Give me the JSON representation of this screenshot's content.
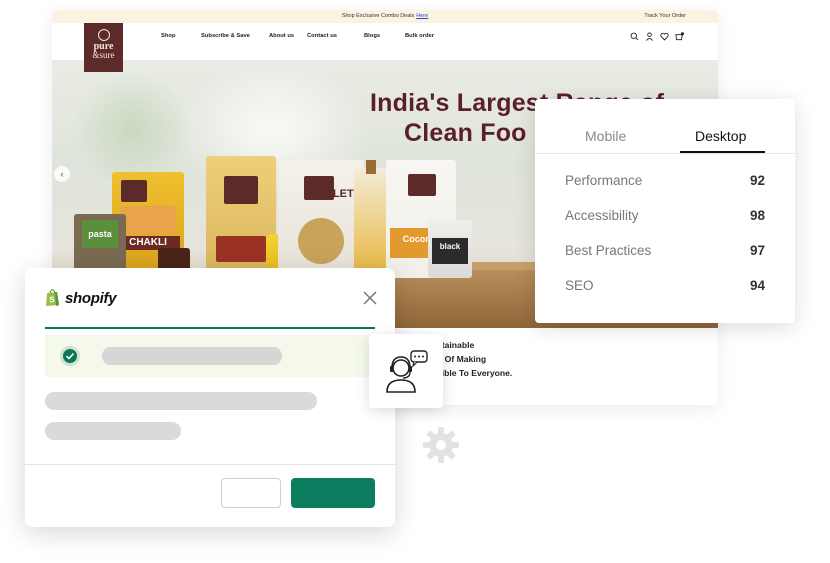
{
  "site": {
    "announcement": "Shop Exclusive Combo Deals",
    "announcement_link": "Here",
    "track_order": "Track Your Order",
    "logo": {
      "line1": "pure",
      "line2": "&sure",
      "small": "ORGANIC"
    },
    "menu": [
      "Shop",
      "Subscribe & Save",
      "About us",
      "Contact us",
      "Blogs",
      "Bulk order"
    ],
    "hero_title_line1": "India's Largest Range of",
    "hero_title_line2": "Clean Foo",
    "tagline_line1": "stainable",
    "tagline_line2": "n Of Making",
    "tagline_line3": "sible To Everyone.",
    "product_labels": {
      "chakli": "CHAKLI",
      "millet": "MILLET",
      "coconut": "Coconut",
      "pasta": "pasta",
      "black": "black"
    }
  },
  "performance": {
    "tabs": {
      "mobile": "Mobile",
      "desktop": "Desktop",
      "active": "Desktop"
    },
    "metrics": [
      {
        "name": "Performance",
        "value": "92"
      },
      {
        "name": "Accessibility",
        "value": "98"
      },
      {
        "name": "Best Practices",
        "value": "97"
      },
      {
        "name": "SEO",
        "value": "94"
      }
    ]
  },
  "modal": {
    "brand": "shopify",
    "brand_color": "#0c7659",
    "success_color": "#0c7659"
  },
  "colors": {
    "accent_green": "#0c7d5e",
    "brand_maroon": "#5c2a28"
  }
}
